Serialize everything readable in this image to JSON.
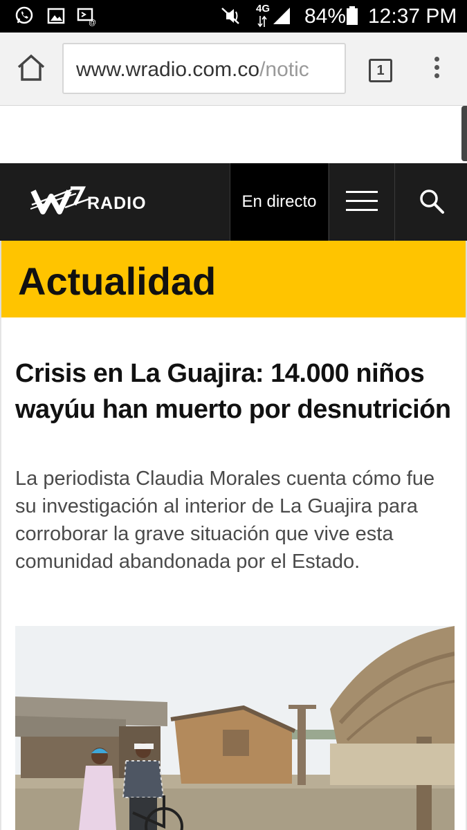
{
  "status_bar": {
    "battery": "84%",
    "time": "12:37 PM",
    "network": "4G",
    "icons": [
      "whatsapp-icon",
      "gallery-icon",
      "screencast-icon",
      "mute-icon",
      "signal-icon",
      "battery-icon"
    ]
  },
  "browser": {
    "url_host": "www.wradio.com.co",
    "url_path": "/notic",
    "tab_count": "1"
  },
  "site_header": {
    "logo_text": "RADIO",
    "live_label": "En directo"
  },
  "section": {
    "title": "Actualidad"
  },
  "article": {
    "headline": "Crisis en La Guajira: 14.000 niños wayúu han muerto por desnutrición",
    "summary": "La periodista Claudia Morales cuenta cómo fue su investigación al interior de La Guajira para corroborar la grave situación que vive esta comunidad abandonada por el Estado."
  },
  "colors": {
    "accent": "#ffc400",
    "header_bg": "#1c1c1c"
  }
}
